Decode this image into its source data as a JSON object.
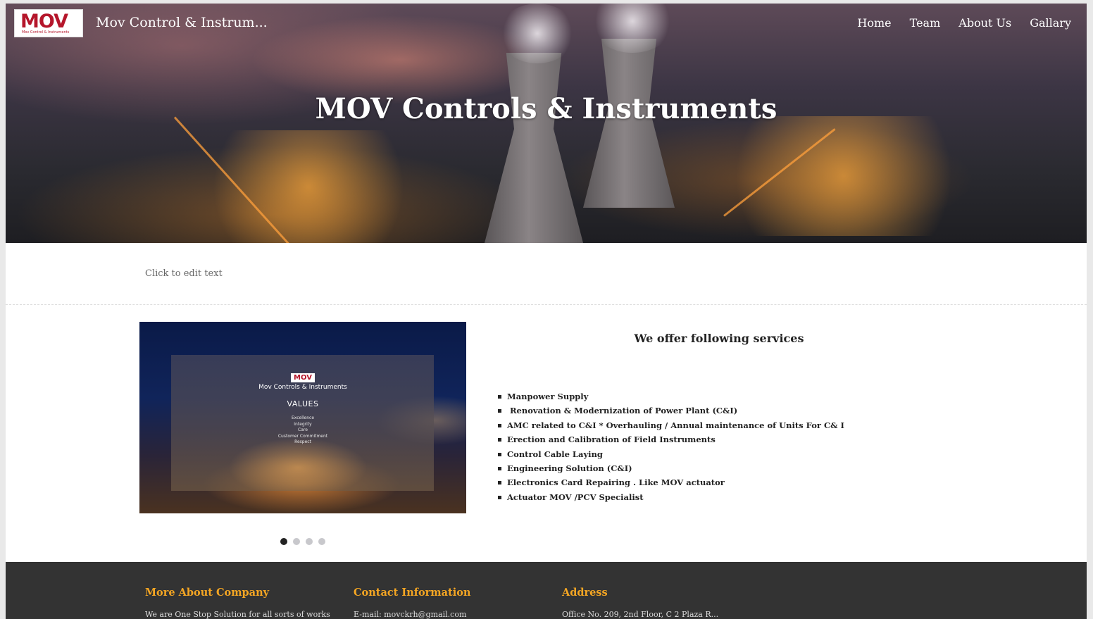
{
  "header": {
    "logo_text": "MOV",
    "logo_subtext": "Mov Control & Instruments",
    "site_name": "Mov Control & Instrum...",
    "nav": [
      "Home",
      "Team",
      "About Us",
      "Gallary"
    ]
  },
  "hero": {
    "title": "MOV Controls & Instruments"
  },
  "edit_text": "Click to edit text",
  "slider": {
    "logo_text": "MOV",
    "company": "Mov Controls & Instruments",
    "heading": "VALUES",
    "values": [
      "Excellence",
      "Integrity",
      "Care",
      "Customer Commitment",
      "Respect"
    ],
    "slide_count": 4,
    "active_slide": 1
  },
  "services": {
    "title": "We offer following services",
    "items": [
      "Manpower Supply",
      " Renovation & Modernization of Power Plant (C&I)",
      "AMC related to C&I * Overhauling / Annual maintenance of Units For C& I",
      "Erection and Calibration of Field Instruments",
      "Control Cable Laying",
      "Engineering Solution (C&I)",
      "Electronics Card Repairing . Like MOV actuator",
      "Actuator MOV /PCV Specialist"
    ]
  },
  "footer": {
    "columns": [
      {
        "heading": "More About Company",
        "text": "We are One Stop Solution for all sorts of works"
      },
      {
        "heading": "Contact Information",
        "text": "E-mail:  movckrh@gmail.com"
      },
      {
        "heading": "Address",
        "text": "Office No. 209, 2nd Floor, C 2 Plaza R..."
      }
    ]
  },
  "colors": {
    "accent": "#f5a623",
    "brand_red": "#b5162b",
    "footer_bg": "#333333"
  }
}
